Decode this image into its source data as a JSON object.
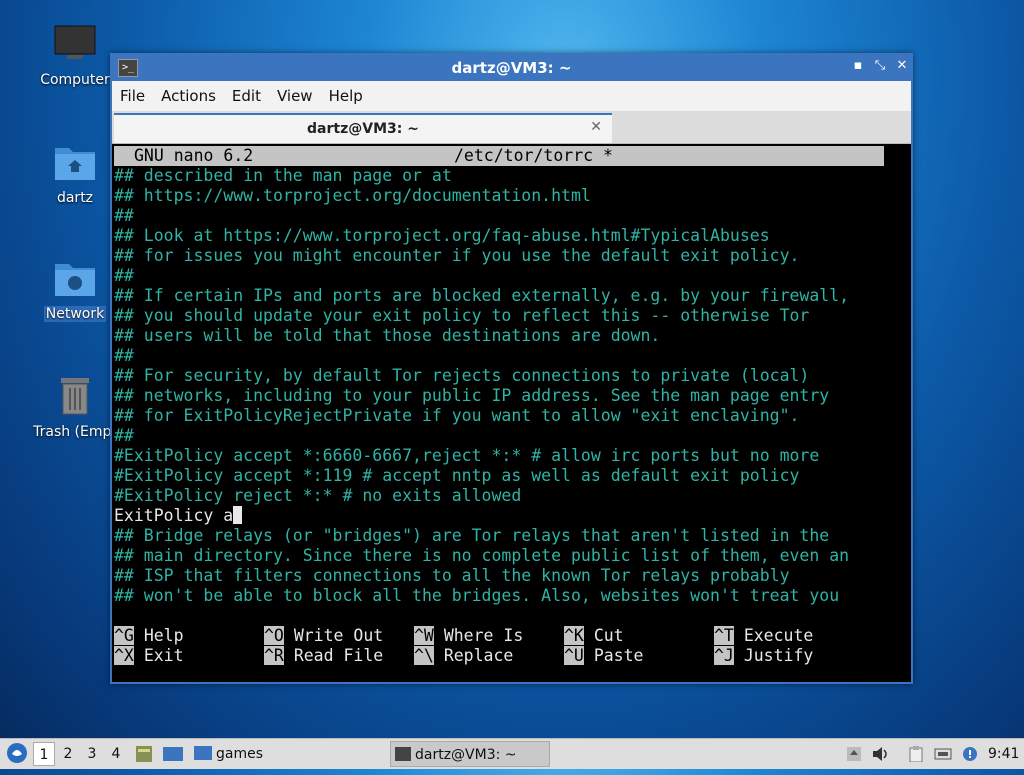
{
  "desktop": {
    "icons": [
      {
        "label": "Computer"
      },
      {
        "label": "dartz"
      },
      {
        "label": "Network"
      },
      {
        "label": "Trash (Empt"
      }
    ]
  },
  "window": {
    "title": "dartz@VM3: ~",
    "menu": [
      "File",
      "Actions",
      "Edit",
      "View",
      "Help"
    ],
    "tab_title": "dartz@VM3: ~",
    "buttons": {
      "minimize": "▪",
      "maximize": "⤡",
      "close": "✕"
    }
  },
  "nano": {
    "header_left": "GNU nano 6.2",
    "header_file": "/etc/tor/torrc *",
    "lines": [
      "## described in the man page or at",
      "## https://www.torproject.org/documentation.html",
      "##",
      "## Look at https://www.torproject.org/faq-abuse.html#TypicalAbuses",
      "## for issues you might encounter if you use the default exit policy.",
      "##",
      "## If certain IPs and ports are blocked externally, e.g. by your firewall,",
      "## you should update your exit policy to reflect this -- otherwise Tor",
      "## users will be told that those destinations are down.",
      "##",
      "## For security, by default Tor rejects connections to private (local)",
      "## networks, including to your public IP address. See the man page entry",
      "## for ExitPolicyRejectPrivate if you want to allow \"exit enclaving\".",
      "##",
      "#ExitPolicy accept *:6660-6667,reject *:* # allow irc ports but no more",
      "#ExitPolicy accept *:119 # accept nntp as well as default exit policy",
      "#ExitPolicy reject *:* # no exits allowed",
      "ExitPolicy a",
      "## Bridge relays (or \"bridges\") are Tor relays that aren't listed in the",
      "## main directory. Since there is no complete public list of them, even an",
      "## ISP that filters connections to all the known Tor relays probably",
      "## won't be able to block all the bridges. Also, websites won't treat you"
    ],
    "shortcuts_row1": [
      {
        "key": "^G",
        "label": "Help"
      },
      {
        "key": "^O",
        "label": "Write Out"
      },
      {
        "key": "^W",
        "label": "Where Is"
      },
      {
        "key": "^K",
        "label": "Cut"
      },
      {
        "key": "^T",
        "label": "Execute"
      }
    ],
    "shortcuts_row2": [
      {
        "key": "^X",
        "label": "Exit"
      },
      {
        "key": "^R",
        "label": "Read File"
      },
      {
        "key": "^\\",
        "label": "Replace"
      },
      {
        "key": "^U",
        "label": "Paste"
      },
      {
        "key": "^J",
        "label": "Justify"
      }
    ]
  },
  "taskbar": {
    "workspaces": [
      "1",
      "2",
      "3",
      "4"
    ],
    "folder_label": "games",
    "task_label": "dartz@VM3: ~",
    "clock": "9:41"
  }
}
